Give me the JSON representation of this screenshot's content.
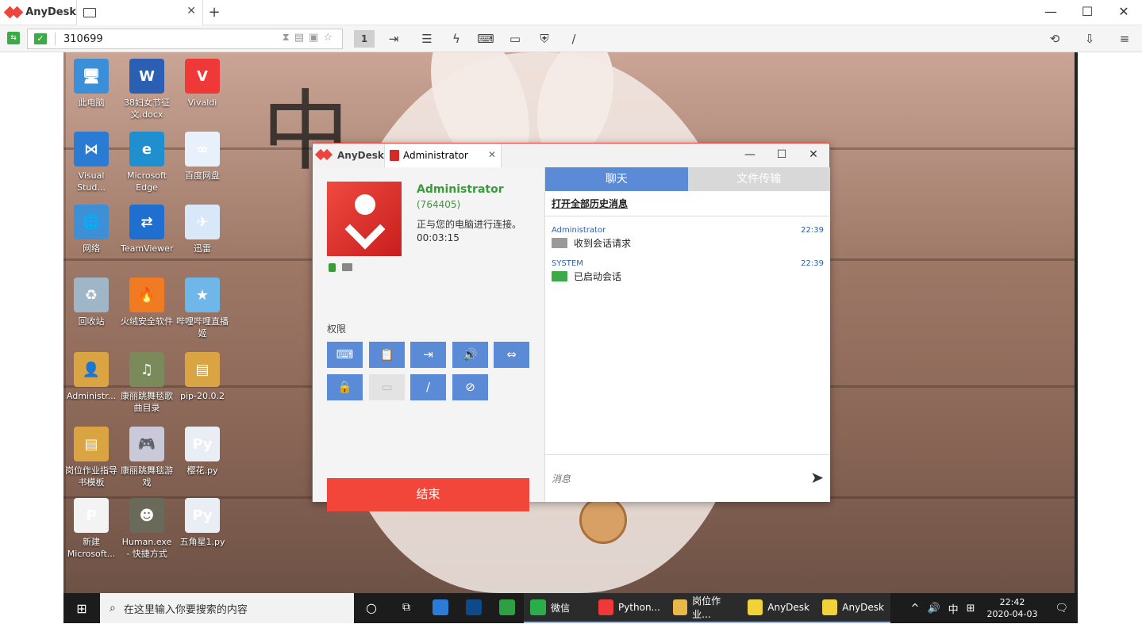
{
  "app": {
    "brand": "AnyDesk"
  },
  "window_controls": {
    "minimize": "—",
    "maximize": "☐",
    "close": "✕"
  },
  "tab": {
    "close": "✕",
    "new": "+"
  },
  "toolbar": {
    "address": "310699",
    "monitor_number": "1"
  },
  "desktop_icons": [
    {
      "label": "此电脑",
      "color": "#3b8fd9",
      "glyph": "🖥"
    },
    {
      "label": "38妇女节征文.docx",
      "color": "#2b5fb4",
      "glyph": "W"
    },
    {
      "label": "Vivaldi",
      "color": "#ef3939",
      "glyph": "V"
    },
    {
      "label": "Visual Stud...",
      "color": "#2a7bd4",
      "glyph": "⋈"
    },
    {
      "label": "Microsoft Edge",
      "color": "#1f8fcf",
      "glyph": "e"
    },
    {
      "label": "百度网盘",
      "color": "#e8f1fb",
      "glyph": "∞"
    },
    {
      "label": "网络",
      "color": "#3d8fd6",
      "glyph": "🌐"
    },
    {
      "label": "TeamViewer",
      "color": "#1e6fd0",
      "glyph": "⇄"
    },
    {
      "label": "迅雷",
      "color": "#d9e8f8",
      "glyph": "✈"
    },
    {
      "label": "回收站",
      "color": "#9fb6c9",
      "glyph": "♻"
    },
    {
      "label": "火绒安全软件",
      "color": "#f07b22",
      "glyph": "🔥"
    },
    {
      "label": "哔哩哔哩直播姬",
      "color": "#6fb7e8",
      "glyph": "★"
    },
    {
      "label": "Administr...",
      "color": "#d9a441",
      "glyph": "👤"
    },
    {
      "label": "康丽跳舞毯歌曲目录",
      "color": "#7a8a5a",
      "glyph": "♫"
    },
    {
      "label": "pip-20.0.2",
      "color": "#d9a441",
      "glyph": "▤"
    },
    {
      "label": "岗位作业指导书模板",
      "color": "#d9a441",
      "glyph": "▤"
    },
    {
      "label": "康丽跳舞毯游戏",
      "color": "#c9c9d9",
      "glyph": "🎮"
    },
    {
      "label": "樱花.py",
      "color": "#e9eef5",
      "glyph": "Py"
    },
    {
      "label": "新建 Microsoft...",
      "color": "#f3f3f3",
      "glyph": "P"
    },
    {
      "label": "Human.exe - 快捷方式",
      "color": "#6a6a5a",
      "glyph": "☻"
    },
    {
      "label": "五角星1.py",
      "color": "#e9eef5",
      "glyph": "Py"
    }
  ],
  "taskbar": {
    "search_placeholder": "在这里输入你要搜索的内容",
    "apps": [
      {
        "label": "",
        "color": "#2b7bd9"
      },
      {
        "label": "",
        "color": "#0e4a8a"
      },
      {
        "label": "",
        "color": "#2ea043"
      },
      {
        "label": "微信",
        "color": "#2aae4a"
      },
      {
        "label": "Python...",
        "color": "#ef3939"
      },
      {
        "label": "岗位作业...",
        "color": "#e8b84a"
      },
      {
        "label": "AnyDesk",
        "color": "#f2d23a"
      },
      {
        "label": "AnyDesk",
        "color": "#f2d23a"
      }
    ],
    "tray_up": "^",
    "tray_volume": "🔊",
    "tray_lang": "中",
    "tray_ime": "⊞",
    "time": "22:42",
    "date": "2020-04-03",
    "notify": "🗨"
  },
  "dialog": {
    "brand": "AnyDesk",
    "tab_label": "Administrator",
    "tab_close": "✕",
    "controls": {
      "minimize": "—",
      "maximize": "☐",
      "close": "✕"
    },
    "user": {
      "name": "Administrator",
      "id": "(764405)",
      "status": "正与您的电脑进行连接。 00:03:15"
    },
    "permissions_label": "权限",
    "end_button": "结束",
    "chat": {
      "tab_chat": "聊天",
      "tab_files": "文件传输",
      "history_link": "打开全部历史消息",
      "messages": [
        {
          "from": "Administrator",
          "time": "22:39",
          "text": "收到会话请求"
        },
        {
          "from": "SYSTEM",
          "time": "22:39",
          "text": "已启动会话"
        }
      ],
      "input_placeholder": "消息",
      "send": "➤"
    }
  },
  "colors": {
    "accent_red": "#ef443b",
    "permission_blue": "#5b8ad6",
    "online_green": "#3a9b3a"
  }
}
